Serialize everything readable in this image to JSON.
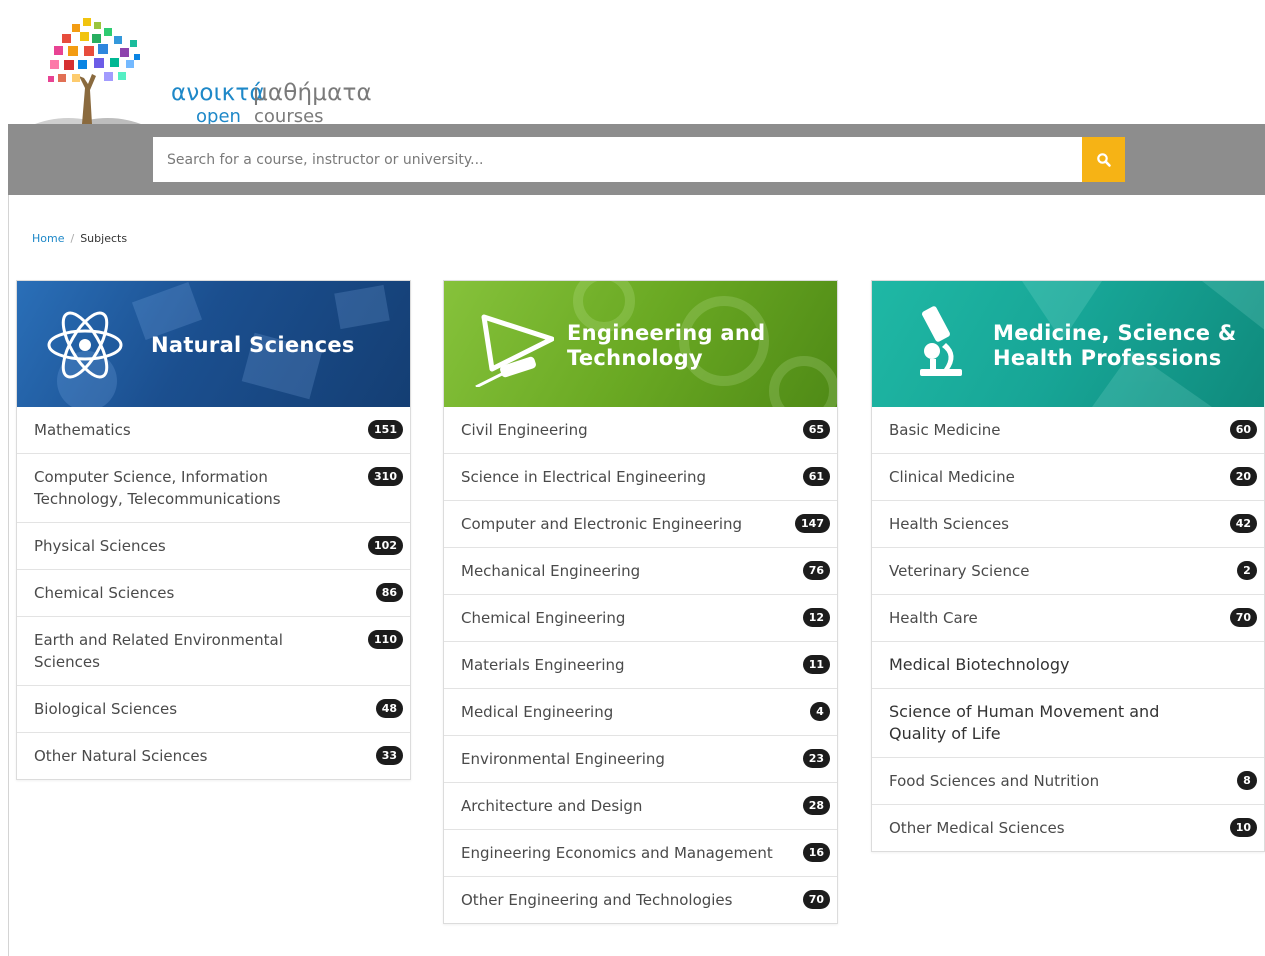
{
  "header": {
    "logo": {
      "greek_strong": "ανοικτά",
      "greek_light": "μαθήματα",
      "en_strong": "open",
      "en_light": "courses"
    },
    "search": {
      "placeholder": "Search for a course, instructor or university..."
    }
  },
  "breadcrumb": {
    "home": "Home",
    "separator": "/",
    "current": "Subjects"
  },
  "columns": [
    {
      "title_line1": "Natural Sciences",
      "title_line2": "",
      "icon": "atom-icon",
      "color": "#1b4f8f",
      "items": [
        {
          "label": "Mathematics",
          "count": "151"
        },
        {
          "label": "Computer Science, Information Technology, Telecommunications",
          "count": "310"
        },
        {
          "label": "Physical Sciences",
          "count": "102"
        },
        {
          "label": "Chemical Sciences",
          "count": "86"
        },
        {
          "label": "Earth and Related Environmental Sciences",
          "count": "110"
        },
        {
          "label": "Biological Sciences",
          "count": "48"
        },
        {
          "label": "Other Natural Sciences",
          "count": "33"
        }
      ]
    },
    {
      "title_line1": "Engineering and",
      "title_line2": "Technology",
      "icon": "engineering-tools-icon",
      "color": "#6aa923",
      "items": [
        {
          "label": "Civil Engineering",
          "count": "65"
        },
        {
          "label": "Science in Electrical Engineering",
          "count": "61"
        },
        {
          "label": "Computer and Electronic Engineering",
          "count": "147"
        },
        {
          "label": "Mechanical Engineering",
          "count": "76"
        },
        {
          "label": "Chemical Engineering",
          "count": "12"
        },
        {
          "label": "Materials Engineering",
          "count": "11"
        },
        {
          "label": "Medical Engineering",
          "count": "4"
        },
        {
          "label": "Environmental Engineering",
          "count": "23"
        },
        {
          "label": "Architecture and Design",
          "count": "28"
        },
        {
          "label": "Engineering Economics and Management",
          "count": "16"
        },
        {
          "label": "Other Engineering and Technologies",
          "count": "70"
        }
      ]
    },
    {
      "title_line1": "Medicine, Science &",
      "title_line2": "Health Professions",
      "icon": "microscope-icon",
      "color": "#17a596",
      "items": [
        {
          "label": "Basic Medicine",
          "count": "60"
        },
        {
          "label": "Clinical Medicine",
          "count": "20"
        },
        {
          "label": "Health Sciences",
          "count": "42"
        },
        {
          "label": "Veterinary Science",
          "count": "2"
        },
        {
          "label": "Health Care",
          "count": "70"
        },
        {
          "label": "Medical Biotechnology",
          "count": ""
        },
        {
          "label": "Science of Human Movement and Quality of Life",
          "count": ""
        },
        {
          "label": "Food Sciences and Nutrition",
          "count": "8"
        },
        {
          "label": "Other Medical Sciences",
          "count": "10"
        }
      ]
    }
  ]
}
